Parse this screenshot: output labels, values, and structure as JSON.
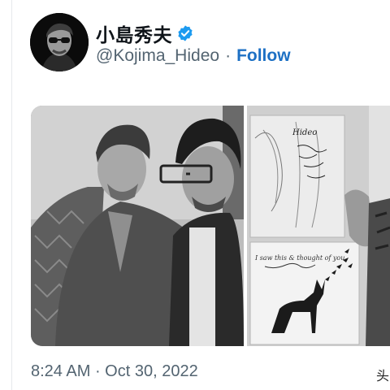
{
  "tweet": {
    "display_name": "小島秀夫",
    "handle": "@Kojima_Hideo",
    "separator": "·",
    "follow_label": "Follow",
    "time": "8:24 AM",
    "date_separator": " · ",
    "date": "Oct 30, 2022",
    "edge_glyph": "头"
  },
  "sketch": {
    "name_text": "Hideo",
    "note_text": "I saw this & thought of you"
  },
  "colors": {
    "link": "#1d70c4",
    "verified": "#1d9bf0",
    "secondary_text": "#536471"
  }
}
